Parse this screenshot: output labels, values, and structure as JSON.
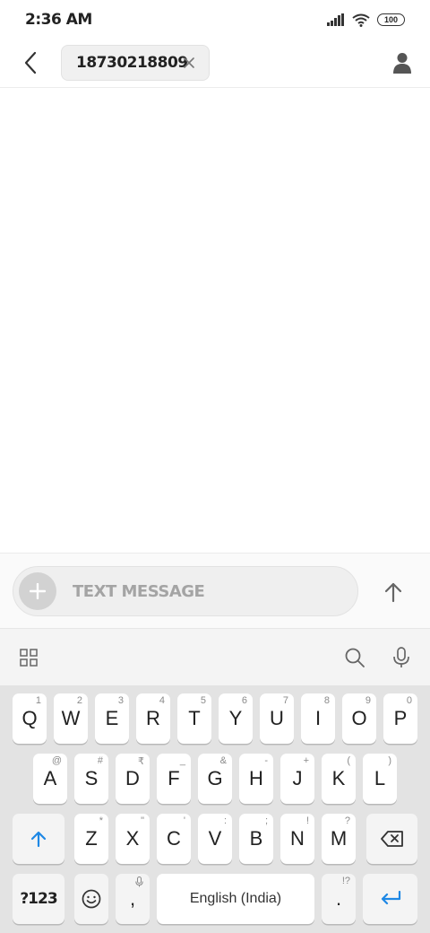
{
  "status_bar": {
    "time": "2:36 AM",
    "battery": "100",
    "icons": [
      "signal-icon",
      "wifi-icon",
      "battery-icon"
    ]
  },
  "header": {
    "back_icon": "back-arrow-icon",
    "recipient": "18730218809",
    "remove_icon": "close-icon",
    "contact_icon": "person-icon"
  },
  "compose": {
    "attach_icon": "plus-icon",
    "placeholder": "TEXT MESSAGE",
    "send_icon": "send-arrow-icon"
  },
  "keyboard_toolbar": {
    "icons": [
      "grid-icon",
      "search-icon",
      "mic-icon"
    ]
  },
  "keyboard": {
    "row1": [
      {
        "label": "Q",
        "hint": "1"
      },
      {
        "label": "W",
        "hint": "2"
      },
      {
        "label": "E",
        "hint": "3"
      },
      {
        "label": "R",
        "hint": "4"
      },
      {
        "label": "T",
        "hint": "5"
      },
      {
        "label": "Y",
        "hint": "6"
      },
      {
        "label": "U",
        "hint": "7"
      },
      {
        "label": "I",
        "hint": "8"
      },
      {
        "label": "O",
        "hint": "9"
      },
      {
        "label": "P",
        "hint": "0"
      }
    ],
    "row2": [
      {
        "label": "A",
        "hint": "@"
      },
      {
        "label": "S",
        "hint": "#"
      },
      {
        "label": "D",
        "hint": "₹"
      },
      {
        "label": "F",
        "hint": "_"
      },
      {
        "label": "G",
        "hint": "&"
      },
      {
        "label": "H",
        "hint": "-"
      },
      {
        "label": "J",
        "hint": "+"
      },
      {
        "label": "K",
        "hint": "("
      },
      {
        "label": "L",
        "hint": ")"
      }
    ],
    "row3": [
      {
        "label": "Z",
        "hint": "*"
      },
      {
        "label": "X",
        "hint": "\""
      },
      {
        "label": "C",
        "hint": "'"
      },
      {
        "label": "V",
        "hint": ":"
      },
      {
        "label": "B",
        "hint": ";"
      },
      {
        "label": "N",
        "hint": "!"
      },
      {
        "label": "M",
        "hint": "?"
      }
    ],
    "symbols_label": "?123",
    "comma_label": ",",
    "space_label": "English (India)",
    "period_label": ".",
    "period_hint": "!?",
    "shift_icon": "shift-arrow-icon",
    "backspace_icon": "backspace-icon",
    "emoji_icon": "emoji-icon",
    "enter_icon": "enter-icon",
    "accent_color": "#1e88e5"
  }
}
